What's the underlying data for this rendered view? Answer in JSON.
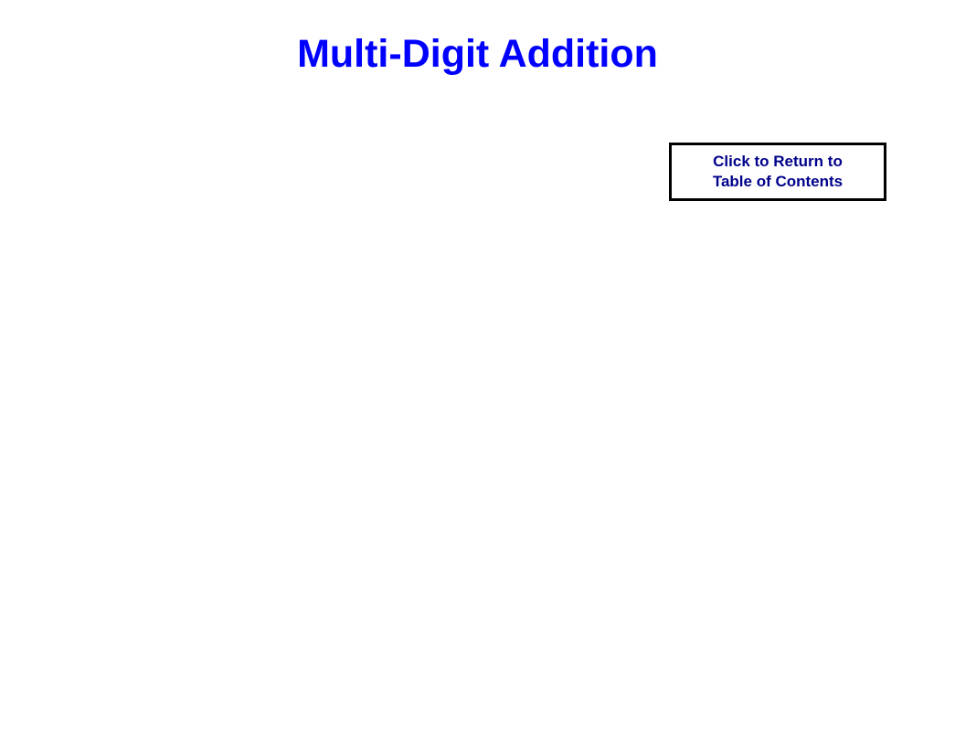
{
  "title": "Multi-Digit Addition",
  "return_button": {
    "line1": "Click to Return to",
    "line2": "Table of Contents"
  }
}
